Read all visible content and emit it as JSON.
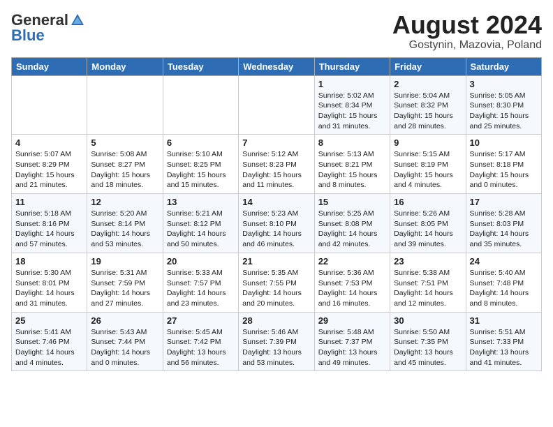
{
  "header": {
    "logo_general": "General",
    "logo_blue": "Blue",
    "month_year": "August 2024",
    "location": "Gostynin, Mazovia, Poland"
  },
  "weekdays": [
    "Sunday",
    "Monday",
    "Tuesday",
    "Wednesday",
    "Thursday",
    "Friday",
    "Saturday"
  ],
  "weeks": [
    [
      {
        "day": "",
        "text": ""
      },
      {
        "day": "",
        "text": ""
      },
      {
        "day": "",
        "text": ""
      },
      {
        "day": "",
        "text": ""
      },
      {
        "day": "1",
        "text": "Sunrise: 5:02 AM\nSunset: 8:34 PM\nDaylight: 15 hours\nand 31 minutes."
      },
      {
        "day": "2",
        "text": "Sunrise: 5:04 AM\nSunset: 8:32 PM\nDaylight: 15 hours\nand 28 minutes."
      },
      {
        "day": "3",
        "text": "Sunrise: 5:05 AM\nSunset: 8:30 PM\nDaylight: 15 hours\nand 25 minutes."
      }
    ],
    [
      {
        "day": "4",
        "text": "Sunrise: 5:07 AM\nSunset: 8:29 PM\nDaylight: 15 hours\nand 21 minutes."
      },
      {
        "day": "5",
        "text": "Sunrise: 5:08 AM\nSunset: 8:27 PM\nDaylight: 15 hours\nand 18 minutes."
      },
      {
        "day": "6",
        "text": "Sunrise: 5:10 AM\nSunset: 8:25 PM\nDaylight: 15 hours\nand 15 minutes."
      },
      {
        "day": "7",
        "text": "Sunrise: 5:12 AM\nSunset: 8:23 PM\nDaylight: 15 hours\nand 11 minutes."
      },
      {
        "day": "8",
        "text": "Sunrise: 5:13 AM\nSunset: 8:21 PM\nDaylight: 15 hours\nand 8 minutes."
      },
      {
        "day": "9",
        "text": "Sunrise: 5:15 AM\nSunset: 8:19 PM\nDaylight: 15 hours\nand 4 minutes."
      },
      {
        "day": "10",
        "text": "Sunrise: 5:17 AM\nSunset: 8:18 PM\nDaylight: 15 hours\nand 0 minutes."
      }
    ],
    [
      {
        "day": "11",
        "text": "Sunrise: 5:18 AM\nSunset: 8:16 PM\nDaylight: 14 hours\nand 57 minutes."
      },
      {
        "day": "12",
        "text": "Sunrise: 5:20 AM\nSunset: 8:14 PM\nDaylight: 14 hours\nand 53 minutes."
      },
      {
        "day": "13",
        "text": "Sunrise: 5:21 AM\nSunset: 8:12 PM\nDaylight: 14 hours\nand 50 minutes."
      },
      {
        "day": "14",
        "text": "Sunrise: 5:23 AM\nSunset: 8:10 PM\nDaylight: 14 hours\nand 46 minutes."
      },
      {
        "day": "15",
        "text": "Sunrise: 5:25 AM\nSunset: 8:08 PM\nDaylight: 14 hours\nand 42 minutes."
      },
      {
        "day": "16",
        "text": "Sunrise: 5:26 AM\nSunset: 8:05 PM\nDaylight: 14 hours\nand 39 minutes."
      },
      {
        "day": "17",
        "text": "Sunrise: 5:28 AM\nSunset: 8:03 PM\nDaylight: 14 hours\nand 35 minutes."
      }
    ],
    [
      {
        "day": "18",
        "text": "Sunrise: 5:30 AM\nSunset: 8:01 PM\nDaylight: 14 hours\nand 31 minutes."
      },
      {
        "day": "19",
        "text": "Sunrise: 5:31 AM\nSunset: 7:59 PM\nDaylight: 14 hours\nand 27 minutes."
      },
      {
        "day": "20",
        "text": "Sunrise: 5:33 AM\nSunset: 7:57 PM\nDaylight: 14 hours\nand 23 minutes."
      },
      {
        "day": "21",
        "text": "Sunrise: 5:35 AM\nSunset: 7:55 PM\nDaylight: 14 hours\nand 20 minutes."
      },
      {
        "day": "22",
        "text": "Sunrise: 5:36 AM\nSunset: 7:53 PM\nDaylight: 14 hours\nand 16 minutes."
      },
      {
        "day": "23",
        "text": "Sunrise: 5:38 AM\nSunset: 7:51 PM\nDaylight: 14 hours\nand 12 minutes."
      },
      {
        "day": "24",
        "text": "Sunrise: 5:40 AM\nSunset: 7:48 PM\nDaylight: 14 hours\nand 8 minutes."
      }
    ],
    [
      {
        "day": "25",
        "text": "Sunrise: 5:41 AM\nSunset: 7:46 PM\nDaylight: 14 hours\nand 4 minutes."
      },
      {
        "day": "26",
        "text": "Sunrise: 5:43 AM\nSunset: 7:44 PM\nDaylight: 14 hours\nand 0 minutes."
      },
      {
        "day": "27",
        "text": "Sunrise: 5:45 AM\nSunset: 7:42 PM\nDaylight: 13 hours\nand 56 minutes."
      },
      {
        "day": "28",
        "text": "Sunrise: 5:46 AM\nSunset: 7:39 PM\nDaylight: 13 hours\nand 53 minutes."
      },
      {
        "day": "29",
        "text": "Sunrise: 5:48 AM\nSunset: 7:37 PM\nDaylight: 13 hours\nand 49 minutes."
      },
      {
        "day": "30",
        "text": "Sunrise: 5:50 AM\nSunset: 7:35 PM\nDaylight: 13 hours\nand 45 minutes."
      },
      {
        "day": "31",
        "text": "Sunrise: 5:51 AM\nSunset: 7:33 PM\nDaylight: 13 hours\nand 41 minutes."
      }
    ]
  ]
}
